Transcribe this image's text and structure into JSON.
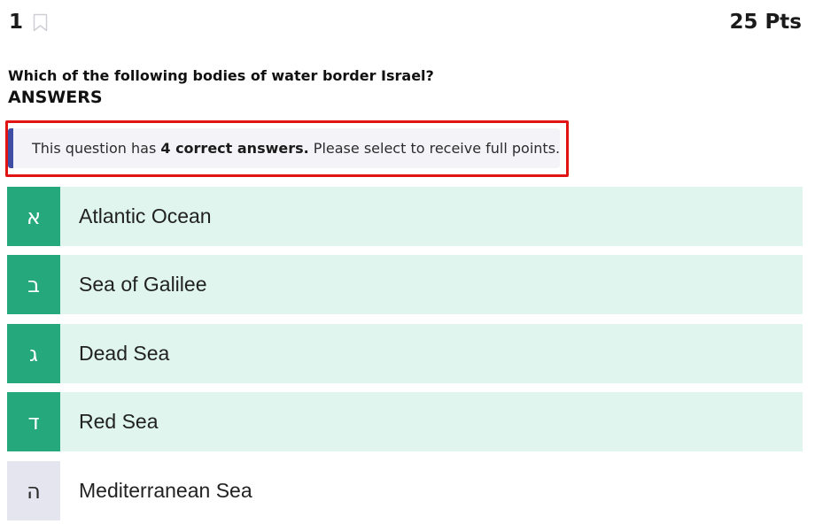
{
  "header": {
    "question_number": "1",
    "points": "25 Pts"
  },
  "question": {
    "text": "Which of the following bodies of water border Israel?",
    "answers_heading": "ANSWERS"
  },
  "notice": {
    "prefix": "This question has ",
    "emphasis": "4 correct answers.",
    "suffix": " Please select to receive full points."
  },
  "options": [
    {
      "letter": "א",
      "label": "Atlantic Ocean",
      "selected": true
    },
    {
      "letter": "ב",
      "label": "Sea of Galilee",
      "selected": true
    },
    {
      "letter": "ג",
      "label": "Dead Sea",
      "selected": true
    },
    {
      "letter": "ד",
      "label": "Red Sea",
      "selected": true
    },
    {
      "letter": "ה",
      "label": "Mediterranean Sea",
      "selected": false
    }
  ],
  "colors": {
    "selected_letter_bg": "#24a87c",
    "selected_row_bg": "#dff5ee",
    "unselected_letter_bg": "#e5e5ef",
    "notice_accent": "#3f4ea3",
    "highlight_frame": "#e11414"
  },
  "icons": {
    "bookmark": "bookmark-icon"
  }
}
